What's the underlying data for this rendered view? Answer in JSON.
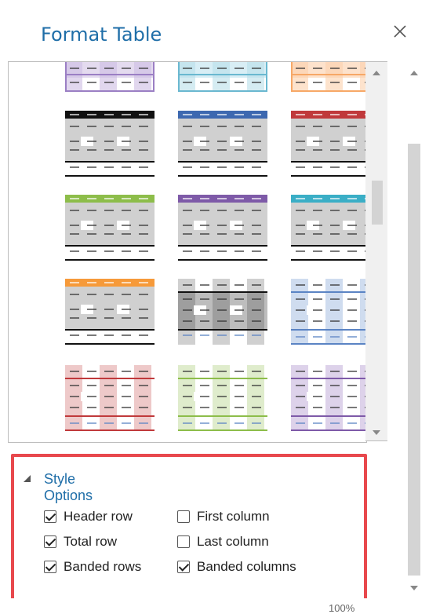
{
  "pane": {
    "title": "Format Table",
    "close_icon": "close-icon"
  },
  "gallery": {
    "rows": [
      [
        {
          "style": "plain-lavender",
          "color": "#9b7fc4",
          "band": "#e4dbef",
          "first": "#cdbde3"
        },
        {
          "style": "plain-teal",
          "color": "#6ab8d0",
          "band": "#d8eef5",
          "first": "#b9dfea"
        },
        {
          "style": "plain-orange",
          "color": "#f7a867",
          "band": "#fde2cc",
          "first": "#fbd0ac"
        }
      ],
      [
        {
          "style": "dark-black",
          "color": "#111111",
          "band": "#d0d0d0"
        },
        {
          "style": "dark-blue",
          "color": "#3d68b0",
          "band": "#d0d0d0"
        },
        {
          "style": "dark-red",
          "color": "#c0393b",
          "band": "#d0d0d0"
        }
      ],
      [
        {
          "style": "dark-green",
          "color": "#8dbd4a",
          "band": "#d0d0d0"
        },
        {
          "style": "dark-purple",
          "color": "#7e5aa8",
          "band": "#d0d0d0"
        },
        {
          "style": "dark-teal",
          "color": "#3aaec6",
          "band": "#d0d0d0"
        }
      ],
      [
        {
          "style": "dark-orange",
          "color": "#f69a3a",
          "band": "#d0d0d0"
        },
        {
          "style": "gray-banded",
          "color": "#111111",
          "band": "#bdbdbd",
          "col": "#9e9e9e"
        },
        {
          "style": "blue-banded",
          "color": "#5b84c4",
          "band": "#ffffff",
          "col": "#cfdcef"
        }
      ],
      [
        {
          "style": "red-banded",
          "color": "#c0393b",
          "band": "#ffffff",
          "col": "#eec9c9"
        },
        {
          "style": "green-banded",
          "color": "#8dbd4a",
          "band": "#ffffff",
          "col": "#dfeccc"
        },
        {
          "style": "purple-banded",
          "color": "#7e5aa8",
          "band": "#ffffff",
          "col": "#ddd2ea"
        }
      ]
    ]
  },
  "style_options": {
    "header": "Style Options",
    "checkboxes": [
      {
        "label": "Header row",
        "checked": true
      },
      {
        "label": "First column",
        "checked": false
      },
      {
        "label": "Total row",
        "checked": true
      },
      {
        "label": "Last column",
        "checked": false
      },
      {
        "label": "Banded rows",
        "checked": true
      },
      {
        "label": "Banded columns",
        "checked": true
      }
    ]
  },
  "status": {
    "zoom": "100%"
  }
}
